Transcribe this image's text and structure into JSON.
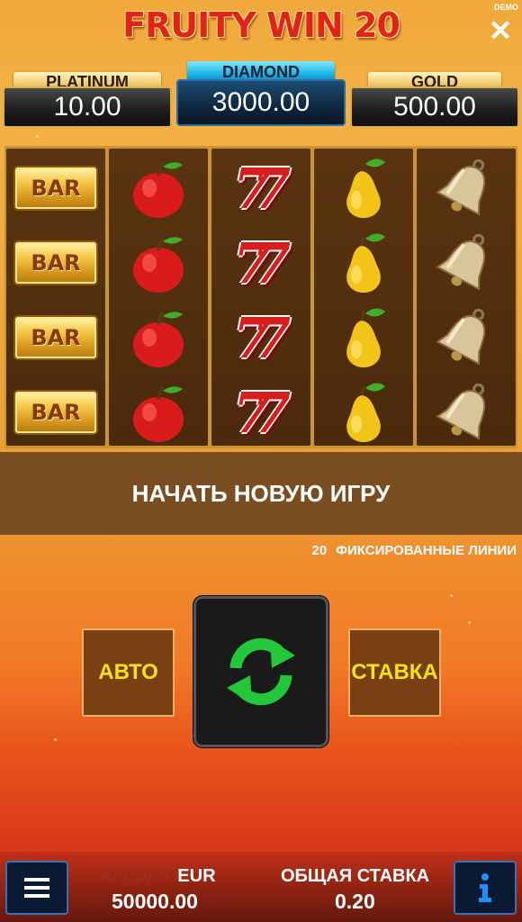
{
  "game": {
    "title": "FRUITY WIN 20",
    "mode_badge": "DEMO",
    "close_icon": "close-icon"
  },
  "jackpots": [
    {
      "name": "PLATINUM",
      "value": "10.00"
    },
    {
      "name": "DIAMOND",
      "value": "3000.00"
    },
    {
      "name": "GOLD",
      "value": "500.00"
    }
  ],
  "reels": [
    {
      "symbol": "bar",
      "label": "BAR"
    },
    {
      "symbol": "apple-icon"
    },
    {
      "symbol": "seven",
      "label": "77"
    },
    {
      "symbol": "pear-icon"
    },
    {
      "symbol": "bell-icon"
    }
  ],
  "message": "НАЧАТЬ НОВУЮ ИГРУ",
  "paylines": {
    "count": "20",
    "label": "ФИКСИРОВАННЫЕ ЛИНИИ"
  },
  "controls": {
    "auto_label": "АВТО",
    "bet_label": "СТАВКА",
    "spin_icon": "refresh-icon"
  },
  "footer": {
    "credit_label": "КРЕДИТ",
    "currency": "EUR",
    "credit_value": "50000.00",
    "total_bet_label": "ОБЩАЯ СТАВКА",
    "total_bet_value": "0.20",
    "menu_icon": "menu-icon",
    "info_icon": "info-icon"
  },
  "colors": {
    "auto_text": "#f4e21a",
    "spin_arrows": "#22c83a",
    "credit_label": "#a22a1a"
  }
}
